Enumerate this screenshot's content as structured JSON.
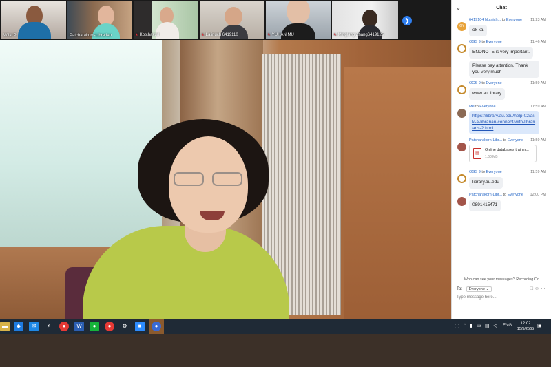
{
  "participants": [
    {
      "name": "Wilai P.",
      "muted": false
    },
    {
      "name": "Patcharakorn-Librarian",
      "muted": false
    },
    {
      "name": "Kotchakud",
      "muted": true
    },
    {
      "name": "Lalinuch 6419110",
      "muted": true
    },
    {
      "name": "YUHAN MU",
      "muted": true
    },
    {
      "name": "Minglang Zhang6419125",
      "muted": true
    }
  ],
  "chat": {
    "title": "Chat",
    "messages": [
      {
        "sender": "6419104 Nutnich...",
        "to": "to",
        "recipient": "Everyone",
        "time": "11:23 AM",
        "bubbles": [
          "ok ka"
        ]
      },
      {
        "sender": "OGS 9",
        "to": "to",
        "recipient": "Everyone",
        "time": "11:46 AM",
        "bubbles": [
          "ENDNOTE is very important.",
          "Please pay attention. Thank you very much"
        ]
      },
      {
        "sender": "OGS 9",
        "to": "to",
        "recipient": "Everyone",
        "time": "11:59 AM",
        "bubbles": [
          "www.au.library"
        ]
      },
      {
        "sender": "Me",
        "to": "to",
        "recipient": "Everyone",
        "time": "11:59 AM",
        "bubbles": [
          "https://library.au.edu/help-02/ask-a-librarian-connect-with-librarians-2.html"
        ]
      },
      {
        "sender": "Patcharakorn-Libr...",
        "to": "to",
        "recipient": "Everyone",
        "time": "11:59 AM",
        "file": {
          "name": "Online databases trainin...",
          "size": "1.60 MB"
        }
      },
      {
        "sender": "OGS 9",
        "to": "to",
        "recipient": "Everyone",
        "time": "11:59 AM",
        "bubbles": [
          "library.au.edu"
        ]
      },
      {
        "sender": "Patcharakorn-Libr...",
        "to": "to",
        "recipient": "Everyone",
        "time": "12:00 PM",
        "bubbles": [
          "0891415471"
        ]
      }
    ],
    "footer_note": "Who can see your messages? Recording On",
    "to_label": "To:",
    "to_value": "Everyone",
    "input_placeholder": "Type message here..."
  },
  "taskbar": {
    "language": "ENG",
    "time": "12:02",
    "date": "15/5/2565"
  },
  "colors": {
    "accent": "#2d6cc8",
    "taskbar": "#1f2a36",
    "muted_icon": "#e0303a"
  }
}
